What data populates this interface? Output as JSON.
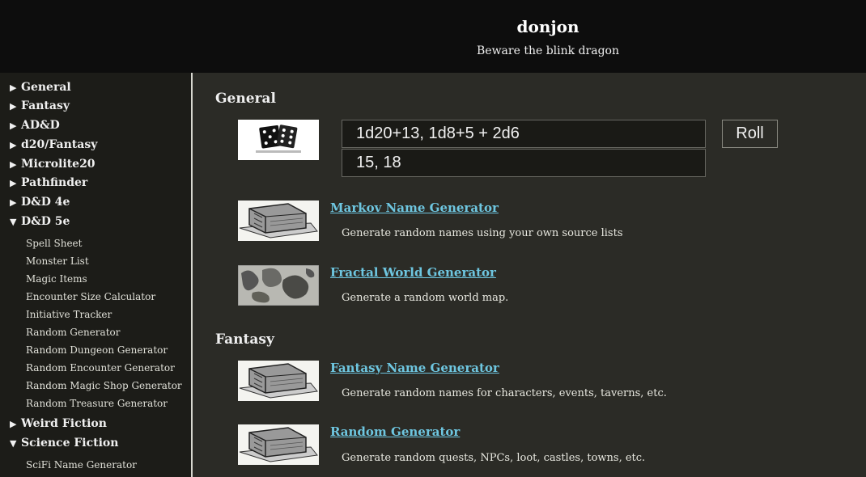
{
  "header": {
    "title": "donjon",
    "tagline": "Beware the blink dragon"
  },
  "sidebar": {
    "categories": [
      {
        "label": "General",
        "arrow": "▶"
      },
      {
        "label": "Fantasy",
        "arrow": "▶"
      },
      {
        "label": "AD&D",
        "arrow": "▶"
      },
      {
        "label": "d20/Fantasy",
        "arrow": "▶"
      },
      {
        "label": "Microlite20",
        "arrow": "▶"
      },
      {
        "label": "Pathfinder",
        "arrow": "▶"
      },
      {
        "label": "D&D 4e",
        "arrow": "▶"
      },
      {
        "label": "D&D 5e",
        "arrow": "▼"
      },
      {
        "label": "Weird Fiction",
        "arrow": "▶"
      },
      {
        "label": "Science Fiction",
        "arrow": "▼"
      }
    ],
    "dnd5e_items": [
      "Spell Sheet",
      "Monster List",
      "Magic Items",
      "Encounter Size Calculator",
      "Initiative Tracker",
      "Random Generator",
      "Random Dungeon Generator",
      "Random Encounter Generator",
      "Random Magic Shop Generator",
      "Random Treasure Generator"
    ],
    "scifi_items": [
      "SciFi Name Generator"
    ]
  },
  "main": {
    "sections": [
      {
        "heading": "General"
      },
      {
        "heading": "Fantasy"
      }
    ],
    "dice": {
      "input_value": "1d20+13, 1d8+5 + 2d6",
      "result": "15, 18",
      "roll_label": "Roll"
    },
    "tools": [
      {
        "title": "Markov Name Generator",
        "description": "Generate random names using your own source lists",
        "icon": "book-icon"
      },
      {
        "title": "Fractal World Generator",
        "description": "Generate a random world map.",
        "icon": "map-icon"
      },
      {
        "title": "Fantasy Name Generator",
        "description": "Generate random names for characters, events, taverns, etc.",
        "icon": "book-icon"
      },
      {
        "title": "Random Generator",
        "description": "Generate random quests, NPCs, loot, castles, towns, etc.",
        "icon": "book-icon"
      }
    ]
  }
}
